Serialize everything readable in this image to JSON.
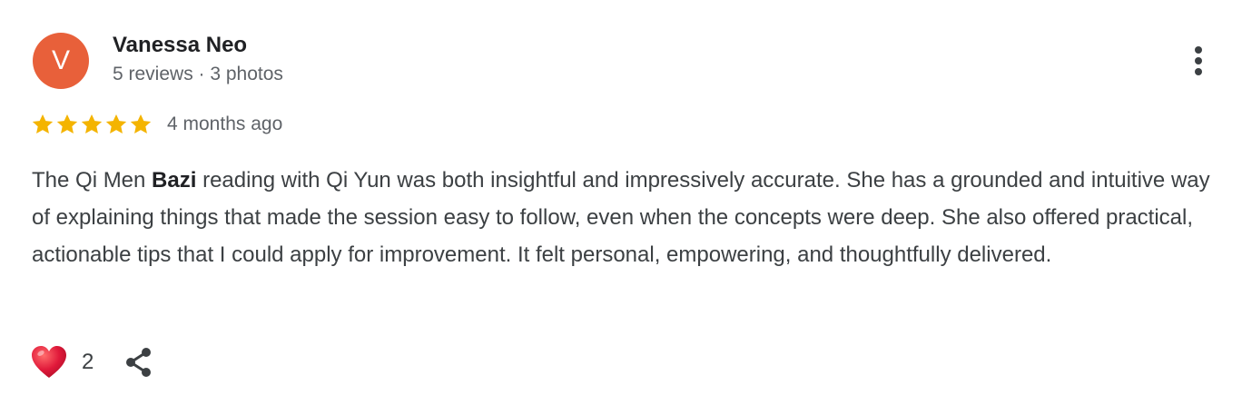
{
  "colors": {
    "avatar_bg": "#e8603a",
    "star": "#f4b400",
    "heart": "#e0193a"
  },
  "reviewer": {
    "initial": "V",
    "name": "Vanessa Neo",
    "meta": "5 reviews · 3 photos"
  },
  "rating": {
    "stars": 5,
    "max_stars": 5,
    "date": "4 months ago"
  },
  "review": {
    "text_before": "The Qi Men ",
    "text_bold": "Bazi",
    "text_after": " reading with Qi Yun was both insightful and impressively accurate. She has a grounded and intuitive way of explaining things that made the session easy to follow, even when the concepts were deep. She also offered practical, actionable tips that I could apply for improvement. It felt personal, empowering, and thoughtfully delivered."
  },
  "actions": {
    "like_icon": "heart-icon",
    "like_count": "2",
    "share_icon": "share-icon",
    "more_icon": "more-vert-icon"
  }
}
